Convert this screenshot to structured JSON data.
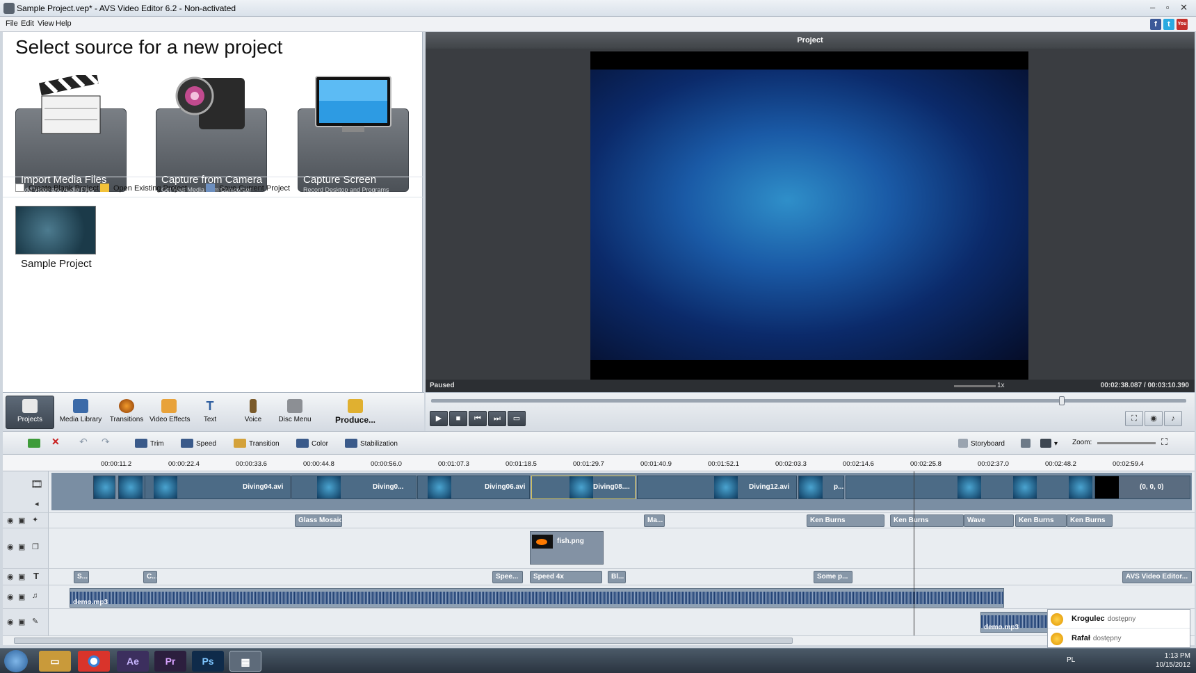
{
  "window": {
    "title": "Sample Project.vep* - AVS Video Editor 6.2 - Non-activated",
    "controls": "– ▫ ✕"
  },
  "menu": {
    "items": [
      "File",
      "Edit",
      "View",
      "Help"
    ],
    "social": [
      "f",
      "t",
      "You"
    ]
  },
  "source_panel": {
    "heading": "Select source for a new project",
    "cards": [
      {
        "title": "Import Media Files",
        "subtitle": "Add Video and Audio Files",
        "icon": "clapperboard-icon"
      },
      {
        "title": "Capture from Camera",
        "subtitle": "Get Your Media from Camcorder",
        "icon": "camcorder-icon"
      },
      {
        "title": "Capture Screen",
        "subtitle": "Record Desktop and Programs",
        "icon": "monitor-icon"
      }
    ],
    "links": [
      "Create Blank Project",
      "Open Existing Project",
      "Save Current Project"
    ],
    "recent_project": "Sample Project"
  },
  "preview": {
    "title": "Project",
    "status": "Paused",
    "rate": "1x",
    "timecode": "00:02:38.087  /  00:03:10.390",
    "progress": 0.835
  },
  "main_toolbar": [
    "Projects",
    "Media Library",
    "Transitions",
    "Video Effects",
    "Text",
    "Voice",
    "Disc Menu",
    "Produce..."
  ],
  "player_controls": [
    "▶",
    "■",
    "⏮",
    "⏭",
    "▭"
  ],
  "timeline_toolbar": {
    "items": [
      "Trim",
      "Speed",
      "Transition",
      "Color",
      "Stabilization"
    ],
    "storyboard": "Storyboard",
    "zoom_label": "Zoom:"
  },
  "ruler": [
    "00:00:11.2",
    "00:00:22.4",
    "00:00:33.6",
    "00:00:44.8",
    "00:00:56.0",
    "00:01:07.3",
    "00:01:18.5",
    "00:01:29.7",
    "00:01:40.9",
    "00:01:52.1",
    "00:02:03.3",
    "00:02:14.6",
    "00:02:25.8",
    "00:02:37.0",
    "00:02:48.2",
    "00:02:59.4"
  ],
  "tracks": {
    "video_labels": [
      "Diving04.avi",
      "Diving0...",
      "Diving06.avi",
      "Diving08....",
      "Diving12.avi",
      "p...",
      "(0, 0, 0)"
    ],
    "effects": [
      "Glass Mosaic",
      "Ma...",
      "Ken Burns",
      "Ken Burns",
      "Wave",
      "Ken Burns",
      "Ken Burns"
    ],
    "overlay": "fish.png",
    "text": [
      "S...",
      "C...",
      "Spee...",
      "Speed 4x",
      "Bl...",
      "Some p...",
      "AVS Video Editor..."
    ],
    "audio": "demo.mp3",
    "audio2": "demo.mp3"
  },
  "chat": [
    {
      "name": "Krogulec",
      "status": "dostępny"
    },
    {
      "name": "Rafał",
      "status": "dostępny"
    }
  ],
  "taskbar": {
    "apps": [
      "Ae",
      "Pr",
      "Ps"
    ],
    "lang": "PL",
    "time": "1:13 PM",
    "date": "10/15/2012"
  }
}
